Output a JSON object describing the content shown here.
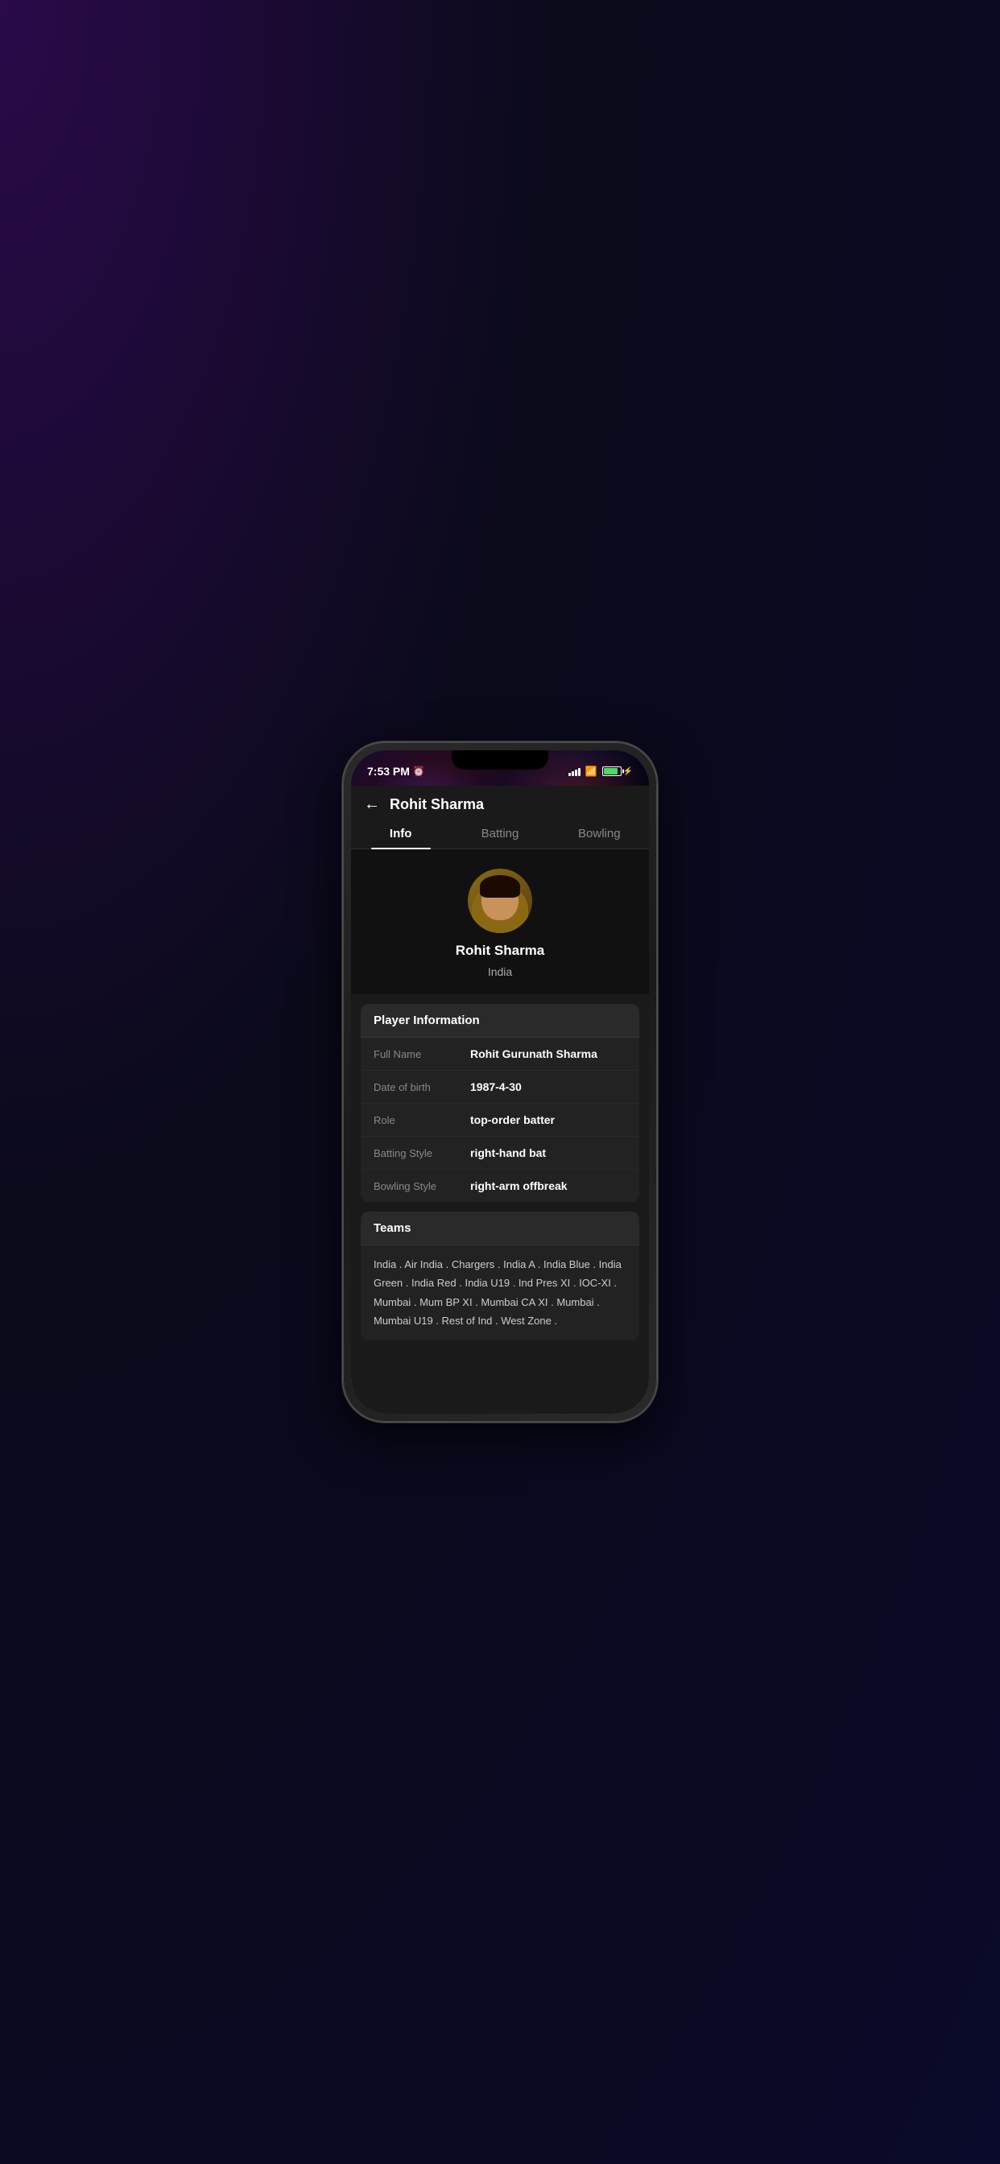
{
  "statusBar": {
    "time": "7:53 PM",
    "alarmIcon": "⏰",
    "batteryPercent": "86"
  },
  "header": {
    "backLabel": "←",
    "title": "Rohit Sharma"
  },
  "tabs": [
    {
      "id": "info",
      "label": "Info",
      "active": true
    },
    {
      "id": "batting",
      "label": "Batting",
      "active": false
    },
    {
      "id": "bowling",
      "label": "Bowling",
      "active": false
    }
  ],
  "profile": {
    "name": "Rohit Sharma",
    "country": "India"
  },
  "playerInfo": {
    "sectionTitle": "Player Information",
    "fields": [
      {
        "label": "Full Name",
        "value": "Rohit Gurunath Sharma"
      },
      {
        "label": "Date of birth",
        "value": "1987-4-30"
      },
      {
        "label": "Role",
        "value": "top-order batter"
      },
      {
        "label": "Batting Style",
        "value": "right-hand bat"
      },
      {
        "label": "Bowling Style",
        "value": "right-arm offbreak"
      }
    ]
  },
  "teams": {
    "sectionTitle": "Teams",
    "content": "India . Air India . Chargers . India A . India Blue . India Green . India Red . India U19 . Ind Pres XI . IOC-XI . Mumbai . Mum BP XI . Mumbai CA XI . Mumbai . Mumbai U19 . Rest of Ind . West Zone ."
  },
  "bottomNav": {
    "squareLabel": "■",
    "circleLabel": "⊙",
    "backLabel": "◄"
  }
}
